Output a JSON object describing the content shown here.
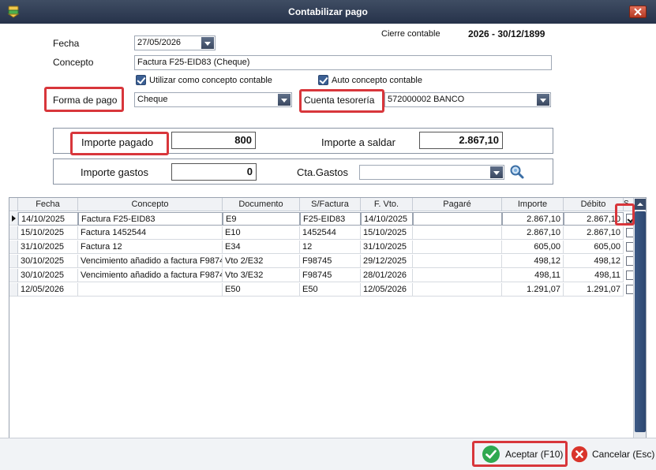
{
  "window": {
    "title": "Contabilizar pago"
  },
  "form": {
    "fecha_label": "Fecha",
    "fecha_value": "27/05/2026",
    "cierre_label": "Cierre contable",
    "cierre_value": "2026 - 30/12/1899",
    "concepto_label": "Concepto",
    "concepto_value": "Factura F25-EID83 (Cheque)",
    "usar_concepto_label": "Utilizar como concepto contable",
    "auto_concepto_label": "Auto concepto contable",
    "forma_pago_label": "Forma de pago",
    "forma_pago_value": "Cheque",
    "cuenta_label": "Cuenta tesorería",
    "cuenta_value": "572000002 BANCO",
    "importe_pagado_label": "Importe pagado",
    "importe_pagado_value": "800",
    "importe_saldar_label": "Importe a saldar",
    "importe_saldar_value": "2.867,10",
    "importe_gastos_label": "Importe gastos",
    "importe_gastos_value": "0",
    "cta_gastos_label": "Cta.Gastos",
    "cta_gastos_value": ""
  },
  "grid": {
    "headers": [
      "Fecha",
      "Concepto",
      "Documento",
      "S/Factura",
      "F. Vto.",
      "Pagaré",
      "Importe",
      "Débito",
      "S..."
    ],
    "rows": [
      {
        "fecha": "14/10/2025",
        "concepto": "Factura F25-EID83",
        "documento": "E9",
        "sfactura": "F25-EID83",
        "fvto": "14/10/2025",
        "pagare": "",
        "importe": "2.867,10",
        "debito": "2.867,10",
        "checked": true
      },
      {
        "fecha": "15/10/2025",
        "concepto": "Factura 1452544",
        "documento": "E10",
        "sfactura": "1452544",
        "fvto": "15/10/2025",
        "pagare": "",
        "importe": "2.867,10",
        "debito": "2.867,10",
        "checked": false
      },
      {
        "fecha": "31/10/2025",
        "concepto": "Factura 12",
        "documento": "E34",
        "sfactura": "12",
        "fvto": "31/10/2025",
        "pagare": "",
        "importe": "605,00",
        "debito": "605,00",
        "checked": false
      },
      {
        "fecha": "30/10/2025",
        "concepto": "Vencimiento añadido a factura F9874",
        "documento": "Vto 2/E32",
        "sfactura": "F98745",
        "fvto": "29/12/2025",
        "pagare": "",
        "importe": "498,12",
        "debito": "498,12",
        "checked": false
      },
      {
        "fecha": "30/10/2025",
        "concepto": "Vencimiento añadido a factura F9874",
        "documento": "Vto 3/E32",
        "sfactura": "F98745",
        "fvto": "28/01/2026",
        "pagare": "",
        "importe": "498,11",
        "debito": "498,11",
        "checked": false
      },
      {
        "fecha": "12/05/2026",
        "concepto": "",
        "documento": "E50",
        "sfactura": "E50",
        "fvto": "12/05/2026",
        "pagare": "",
        "importe": "1.291,07",
        "debito": "1.291,07",
        "checked": false
      }
    ]
  },
  "buttons": {
    "aceptar": "Aceptar (F10)",
    "cancelar": "Cancelar (Esc)"
  },
  "colors": {
    "highlight": "#d8363b",
    "titlebar": "#2f3b52",
    "accept": "#2fa84f",
    "cancel": "#d9342b"
  }
}
